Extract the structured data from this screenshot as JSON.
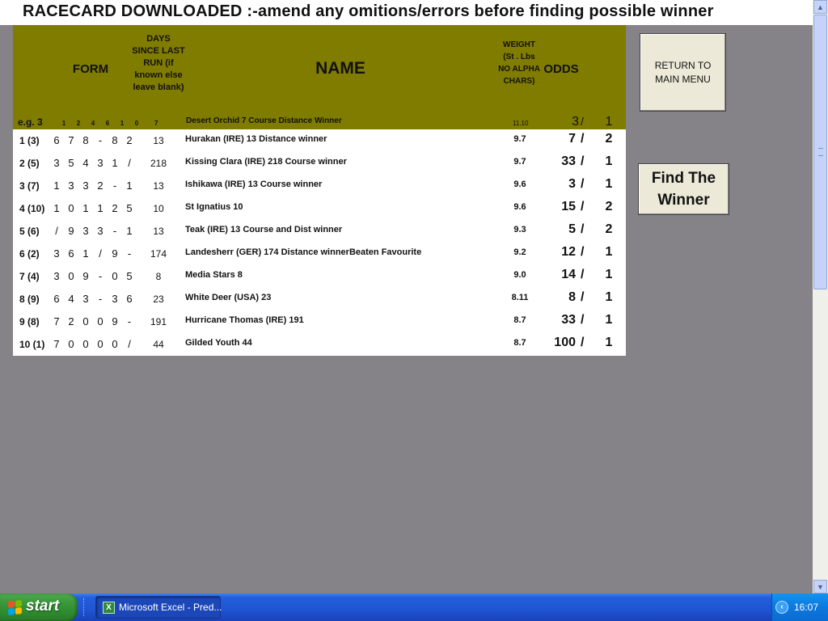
{
  "banner": {
    "title": "RACECARD DOWNLOADED  :-amend any omitions/errors before finding possible winner"
  },
  "table": {
    "headers": {
      "form": "FORM",
      "days_since": "DAYS SINCE LAST RUN (if known else leave blank)",
      "name": "NAME",
      "weight": "WEIGHT (St . Lbs NO ALPHA CHARS)",
      "odds": "ODDS"
    },
    "example": {
      "label": "e.g. 3",
      "form": [
        "1",
        "2",
        "4",
        "6",
        "1",
        "0"
      ],
      "days": "7",
      "name": "Desert Orchid 7 Course Distance Winner",
      "weight": "11.10",
      "odds_num": "3",
      "odds_slash": "/",
      "odds_den": "1"
    },
    "rows": [
      {
        "pos": "1 (3)",
        "form": [
          "6",
          "7",
          "8",
          "-",
          "8",
          "2"
        ],
        "days": "13",
        "name": "Hurakan (IRE) 13 Distance winner",
        "weight": "9.7",
        "odds_num": "7",
        "odds_den": "2"
      },
      {
        "pos": "2 (5)",
        "form": [
          "3",
          "5",
          "4",
          "3",
          "1",
          "/"
        ],
        "days": "218",
        "name": "Kissing Clara (IRE) 218 Course winner",
        "weight": "9.7",
        "odds_num": "33",
        "odds_den": "1"
      },
      {
        "pos": "3 (7)",
        "form": [
          "1",
          "3",
          "3",
          "2",
          "-",
          "1"
        ],
        "days": "13",
        "name": "Ishikawa (IRE) 13 Course winner",
        "weight": "9.6",
        "odds_num": "3",
        "odds_den": "1"
      },
      {
        "pos": "4 (10)",
        "form": [
          "1",
          "0",
          "1",
          "1",
          "2",
          "5"
        ],
        "days": "10",
        "name": "St Ignatius 10",
        "weight": "9.6",
        "odds_num": "15",
        "odds_den": "2"
      },
      {
        "pos": "5 (6)",
        "form": [
          "/",
          "9",
          "3",
          "3",
          "-",
          "1"
        ],
        "days": "13",
        "name": "Teak (IRE) 13 Course and Dist winner",
        "weight": "9.3",
        "odds_num": "5",
        "odds_den": "2"
      },
      {
        "pos": "6 (2)",
        "form": [
          "3",
          "6",
          "1",
          "/",
          "9",
          "-"
        ],
        "days": "174",
        "name": "Landesherr (GER) 174 Distance winnerBeaten Favourite",
        "weight": "9.2",
        "odds_num": "12",
        "odds_den": "1"
      },
      {
        "pos": "7 (4)",
        "form": [
          "3",
          "0",
          "9",
          "-",
          "0",
          "5"
        ],
        "days": "8",
        "name": "Media Stars 8",
        "weight": "9.0",
        "odds_num": "14",
        "odds_den": "1"
      },
      {
        "pos": "8 (9)",
        "form": [
          "6",
          "4",
          "3",
          "-",
          "3",
          "6"
        ],
        "days": "23",
        "name": "White Deer (USA) 23",
        "weight": "8.11",
        "odds_num": "8",
        "odds_den": "1"
      },
      {
        "pos": "9 (8)",
        "form": [
          "7",
          "2",
          "0",
          "0",
          "9",
          "-"
        ],
        "days": "191",
        "name": "Hurricane Thomas (IRE) 191",
        "weight": "8.7",
        "odds_num": "33",
        "odds_den": "1"
      },
      {
        "pos": "10 (1)",
        "form": [
          "7",
          "0",
          "0",
          "0",
          "0",
          "/"
        ],
        "days": "44",
        "name": "Gilded Youth 44",
        "weight": "8.7",
        "odds_num": "100",
        "odds_den": "1"
      }
    ],
    "odds_separator": "/"
  },
  "buttons": {
    "return_label": "RETURN TO MAIN MENU",
    "find_label": "Find The Winner"
  },
  "taskbar": {
    "start_label": "start",
    "task_label": "Microsoft Excel - Pred...",
    "task_icon_glyph": "X",
    "clock": "16:07"
  },
  "colors": {
    "header_band": "#807c00",
    "sheet_background": "#858387"
  }
}
